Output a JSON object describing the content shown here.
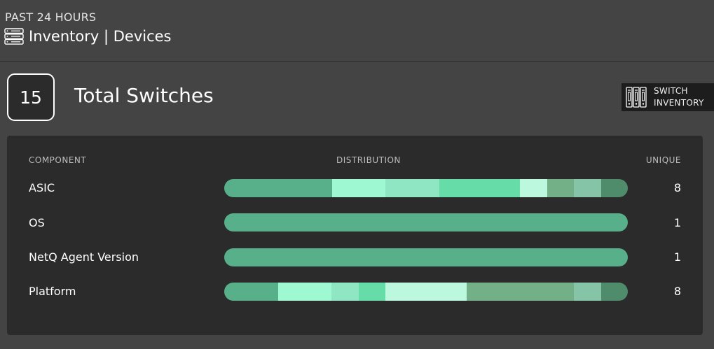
{
  "header": {
    "period": "PAST 24 HOURS",
    "title": "Inventory | Devices",
    "icon": "server-stack-icon"
  },
  "summary": {
    "total_count": "15",
    "total_label": "Total Switches"
  },
  "switch_inventory_button": {
    "label_line1": "SWITCH",
    "label_line2": "INVENTORY",
    "icon": "switch-rack-icon"
  },
  "table": {
    "headers": {
      "component": "COMPONENT",
      "distribution": "DISTRIBUTION",
      "unique": "UNIQUE"
    },
    "rows": [
      {
        "component": "ASIC",
        "unique": "8",
        "distribution": [
          {
            "fraction": 0.267,
            "color": "#57b08a"
          },
          {
            "fraction": 0.133,
            "color": "#9ef8d2"
          },
          {
            "fraction": 0.133,
            "color": "#8ee6c3"
          },
          {
            "fraction": 0.2,
            "color": "#66dca8"
          },
          {
            "fraction": 0.067,
            "color": "#bcf8de"
          },
          {
            "fraction": 0.067,
            "color": "#73b087"
          },
          {
            "fraction": 0.067,
            "color": "#85c4a6"
          },
          {
            "fraction": 0.066,
            "color": "#4f8c6c"
          }
        ]
      },
      {
        "component": "OS",
        "unique": "1",
        "distribution": [
          {
            "fraction": 1.0,
            "color": "#57b08a"
          }
        ]
      },
      {
        "component": "NetQ Agent Version",
        "unique": "1",
        "distribution": [
          {
            "fraction": 1.0,
            "color": "#57b08a"
          }
        ]
      },
      {
        "component": "Platform",
        "unique": "8",
        "distribution": [
          {
            "fraction": 0.133,
            "color": "#57b08a"
          },
          {
            "fraction": 0.133,
            "color": "#9ef8d2"
          },
          {
            "fraction": 0.067,
            "color": "#8ee6c3"
          },
          {
            "fraction": 0.067,
            "color": "#66dca8"
          },
          {
            "fraction": 0.2,
            "color": "#bcf8de"
          },
          {
            "fraction": 0.267,
            "color": "#73b087"
          },
          {
            "fraction": 0.067,
            "color": "#85c4a6"
          },
          {
            "fraction": 0.066,
            "color": "#4f8c6c"
          }
        ]
      }
    ]
  }
}
